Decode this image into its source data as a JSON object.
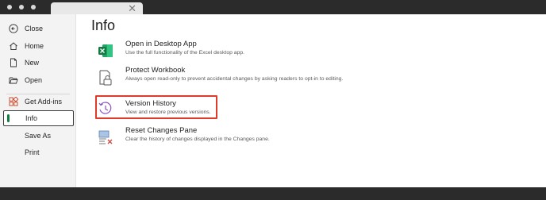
{
  "sidebar": {
    "items": [
      {
        "label": "Close",
        "icon": "back-circle-icon"
      },
      {
        "label": "Home",
        "icon": "home-icon"
      },
      {
        "label": "New",
        "icon": "new-document-icon"
      },
      {
        "label": "Open",
        "icon": "folder-open-icon"
      },
      {
        "label": "Get Add-ins",
        "icon": "add-ins-grid-icon"
      },
      {
        "label": "Info",
        "icon": "",
        "active": true
      },
      {
        "label": "Save As",
        "icon": ""
      },
      {
        "label": "Print",
        "icon": ""
      }
    ]
  },
  "main": {
    "title": "Info",
    "options": [
      {
        "title": "Open in Desktop App",
        "description": "Use the full functionality of the Excel desktop app.",
        "icon": "excel-icon"
      },
      {
        "title": "Protect Workbook",
        "description": "Always open read-only to prevent accidental changes by asking readers to opt-in to editing.",
        "icon": "lock-document-icon"
      },
      {
        "title": "Version History",
        "description": "View and restore previous versions.",
        "icon": "history-clock-icon",
        "highlighted": true
      },
      {
        "title": "Reset Changes Pane",
        "description": "Clear the history of changes displayed in the Changes pane.",
        "icon": "reset-pane-icon"
      }
    ]
  },
  "colors": {
    "accent": "#107c41",
    "highlight": "#e03b2a",
    "titlebar": "#2b2b2b",
    "sidebar": "#f3f3f3"
  }
}
